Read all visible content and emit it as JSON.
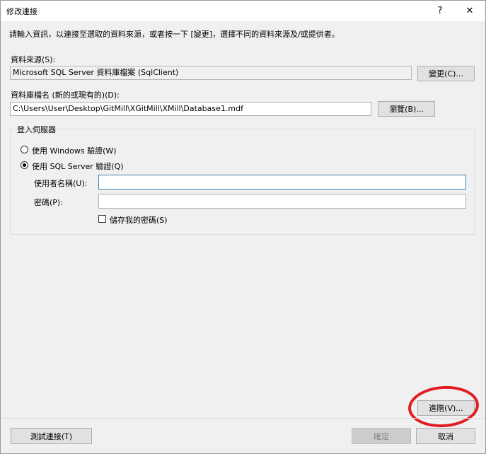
{
  "window": {
    "title": "修改連接",
    "help_glyph": "?",
    "close_glyph": "✕"
  },
  "instructions": "請輸入資訊，以連接至選取的資料來源，或者按一下 [變更]，選擇不同的資料來源及/或提供者。",
  "data_source": {
    "label": "資料來源(S):",
    "value": "Microsoft SQL Server 資料庫檔案 (SqlClient)",
    "change_button": "變更(C)..."
  },
  "database_file": {
    "label": "資料庫檔名 (新的或現有的)(D):",
    "value": "C:\\Users\\User\\Desktop\\GitMill\\XGitMill\\XMill\\Database1.mdf",
    "browse_button": "瀏覽(B)..."
  },
  "login": {
    "group_label": "登入伺服器",
    "windows_auth": "使用 Windows 驗證(W)",
    "sql_auth": "使用 SQL Server 驗證(Q)",
    "selected": "sql_auth",
    "username_label": "使用者名稱(U):",
    "username_value": "",
    "password_label": "密碼(P):",
    "password_value": "",
    "save_password_label": "儲存我的密碼(S)",
    "save_password_checked": false
  },
  "buttons": {
    "advanced": "進階(V)...",
    "test_connection": "測試連接(T)",
    "ok": "確定",
    "cancel": "取消"
  },
  "colors": {
    "dialog_bg": "#f0f0f0",
    "annotation_red": "#e31b23",
    "focus_border": "#3c7fb1"
  }
}
